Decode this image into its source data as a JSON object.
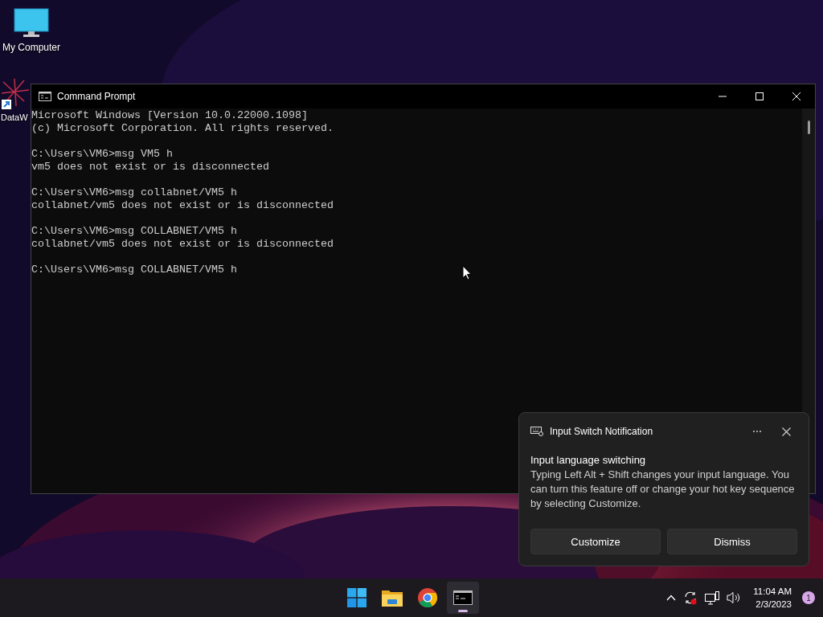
{
  "desktop_icons": [
    {
      "kind": "computer",
      "label": "My Computer"
    },
    {
      "kind": "shortcut",
      "label": "DataW"
    }
  ],
  "console_window": {
    "title": "Command Prompt",
    "blocks": [
      [
        "Microsoft Windows [Version 10.0.22000.1098]",
        "(c) Microsoft Corporation. All rights reserved."
      ],
      [
        "C:\\Users\\VM6>msg VM5 h",
        "vm5 does not exist or is disconnected"
      ],
      [
        "C:\\Users\\VM6>msg collabnet/VM5 h",
        "collabnet/vm5 does not exist or is disconnected"
      ],
      [
        "C:\\Users\\VM6>msg COLLABNET/VM5 h",
        "collabnet/vm5 does not exist or is disconnected"
      ],
      [
        "C:\\Users\\VM6>msg COLLABNET/VM5 h"
      ]
    ]
  },
  "notification": {
    "app": "Input Switch Notification",
    "heading": "Input language switching",
    "body": "Typing Left Alt + Shift changes your input language. You can turn this feature off or change your hot key sequence by selecting Customize.",
    "buttons": [
      "Customize",
      "Dismiss"
    ]
  },
  "taskbar": {
    "apps": [
      {
        "kind": "start",
        "selected": false
      },
      {
        "kind": "explorer",
        "selected": false
      },
      {
        "kind": "chrome",
        "selected": false
      },
      {
        "kind": "terminal",
        "selected": true
      }
    ],
    "tray": {
      "time": "11:04 AM",
      "date": "2/3/2023",
      "badge": "1"
    }
  }
}
